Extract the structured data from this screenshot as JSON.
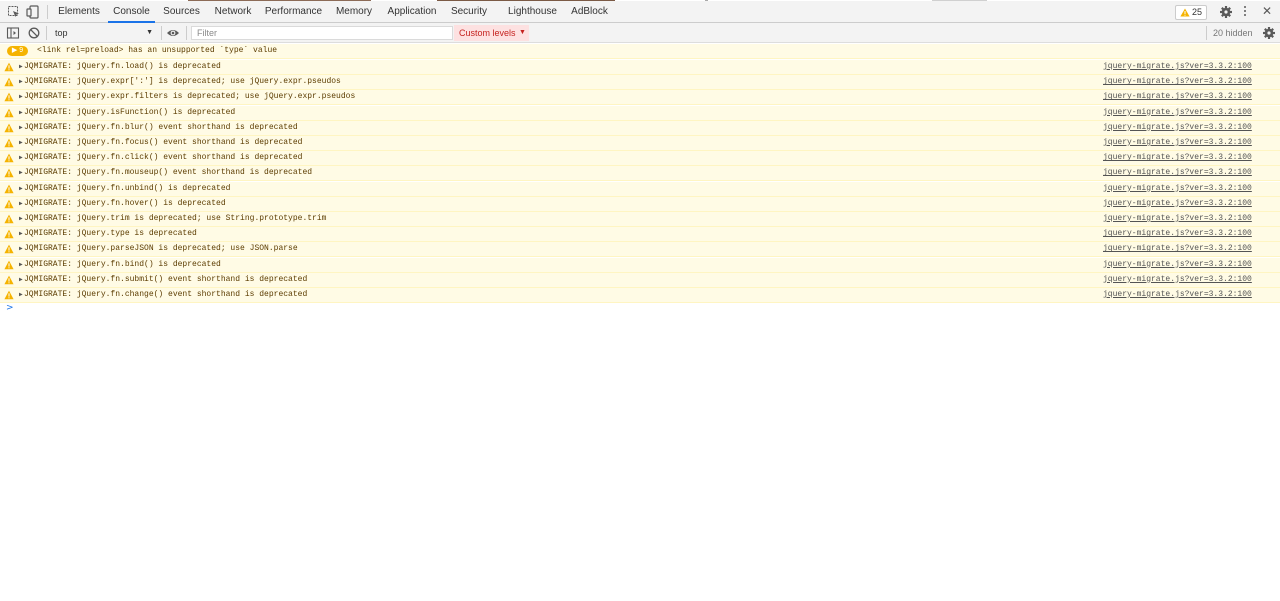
{
  "tabs": [
    {
      "label": "Elements",
      "active": false
    },
    {
      "label": "Console",
      "active": true
    },
    {
      "label": "Sources",
      "active": false
    },
    {
      "label": "Network",
      "active": false
    },
    {
      "label": "Performance",
      "active": false
    },
    {
      "label": "Memory",
      "active": false
    },
    {
      "label": "Application",
      "active": false
    },
    {
      "label": "Security",
      "active": false
    },
    {
      "label": "Lighthouse",
      "active": false
    },
    {
      "label": "AdBlock",
      "active": false
    }
  ],
  "warnings_badge": {
    "count": "25"
  },
  "toolbar": {
    "context": "top",
    "filter_placeholder": "Filter",
    "levels_label": "Custom levels",
    "hidden_count": "20 hidden"
  },
  "group_message": {
    "count": "9",
    "text": "<link rel=preload> has an unsupported `type` value"
  },
  "messages": [
    {
      "text": "JQMIGRATE: jQuery.fn.load() is deprecated",
      "source": "jquery-migrate.js?ver=3.3.2:100"
    },
    {
      "text": "JQMIGRATE: jQuery.expr[':'] is deprecated; use jQuery.expr.pseudos",
      "source": "jquery-migrate.js?ver=3.3.2:100"
    },
    {
      "text": "JQMIGRATE: jQuery.expr.filters is deprecated; use jQuery.expr.pseudos",
      "source": "jquery-migrate.js?ver=3.3.2:100"
    },
    {
      "text": "JQMIGRATE: jQuery.isFunction() is deprecated",
      "source": "jquery-migrate.js?ver=3.3.2:100"
    },
    {
      "text": "JQMIGRATE: jQuery.fn.blur() event shorthand is deprecated",
      "source": "jquery-migrate.js?ver=3.3.2:100"
    },
    {
      "text": "JQMIGRATE: jQuery.fn.focus() event shorthand is deprecated",
      "source": "jquery-migrate.js?ver=3.3.2:100"
    },
    {
      "text": "JQMIGRATE: jQuery.fn.click() event shorthand is deprecated",
      "source": "jquery-migrate.js?ver=3.3.2:100"
    },
    {
      "text": "JQMIGRATE: jQuery.fn.mouseup() event shorthand is deprecated",
      "source": "jquery-migrate.js?ver=3.3.2:100"
    },
    {
      "text": "JQMIGRATE: jQuery.fn.unbind() is deprecated",
      "source": "jquery-migrate.js?ver=3.3.2:100"
    },
    {
      "text": "JQMIGRATE: jQuery.fn.hover() is deprecated",
      "source": "jquery-migrate.js?ver=3.3.2:100"
    },
    {
      "text": "JQMIGRATE: jQuery.trim is deprecated; use String.prototype.trim",
      "source": "jquery-migrate.js?ver=3.3.2:100"
    },
    {
      "text": "JQMIGRATE: jQuery.type is deprecated",
      "source": "jquery-migrate.js?ver=3.3.2:100"
    },
    {
      "text": "JQMIGRATE: jQuery.parseJSON is deprecated; use JSON.parse",
      "source": "jquery-migrate.js?ver=3.3.2:100"
    },
    {
      "text": "JQMIGRATE: jQuery.fn.bind() is deprecated",
      "source": "jquery-migrate.js?ver=3.3.2:100"
    },
    {
      "text": "JQMIGRATE: jQuery.fn.submit() event shorthand is deprecated",
      "source": "jquery-migrate.js?ver=3.3.2:100"
    },
    {
      "text": "JQMIGRATE: jQuery.fn.change() event shorthand is deprecated",
      "source": "jquery-migrate.js?ver=3.3.2:100"
    }
  ],
  "prompt_symbol": ">",
  "colors": {
    "accent": "#1a73e8",
    "warning_bg": "#fffbe5",
    "warning_text": "#5c3c00",
    "warning_icon": "#f5b300",
    "levels_bg": "#fde1e1",
    "levels_text": "#c5221f"
  }
}
